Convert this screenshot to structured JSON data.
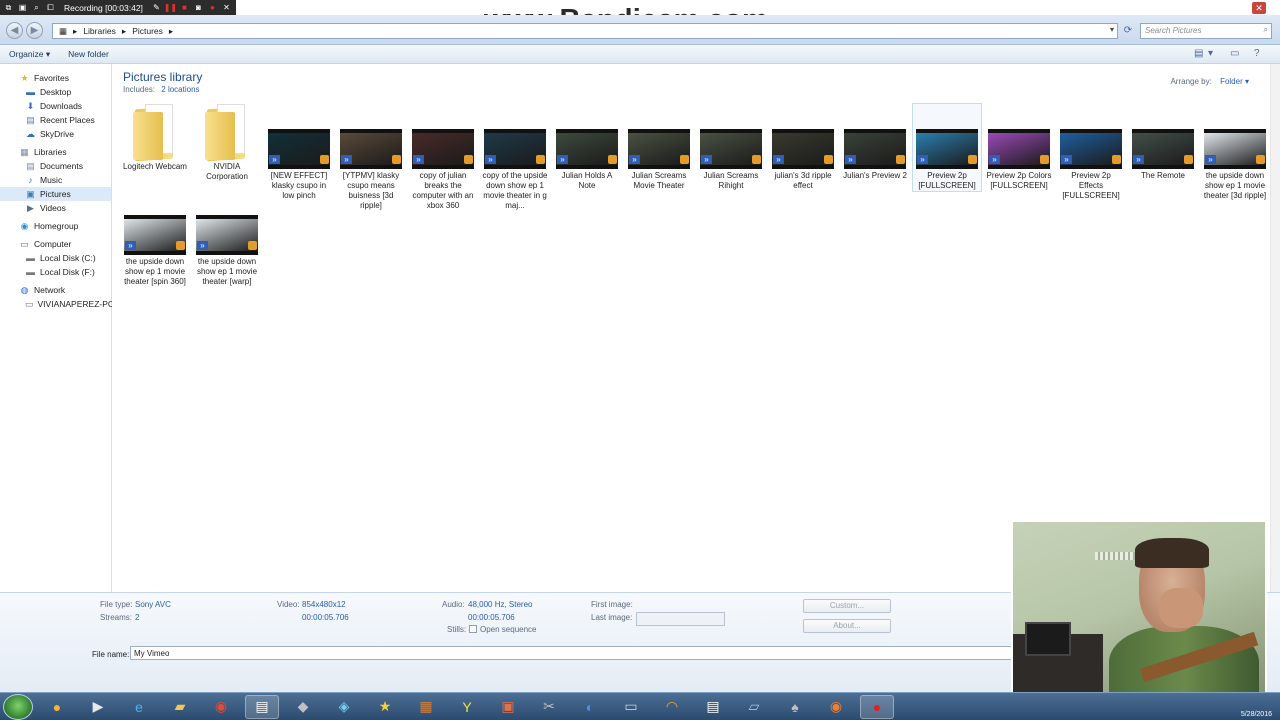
{
  "recorder": {
    "title": "Recording [00:03:42]",
    "watermark": "www.Bandicam.com"
  },
  "address_bar": {
    "segments": [
      "Libraries",
      "Pictures"
    ],
    "search_placeholder": "Search Pictures"
  },
  "command_bar": {
    "organize": "Organize",
    "new_folder": "New folder"
  },
  "nav_pane": {
    "favorites": "Favorites",
    "desktop": "Desktop",
    "downloads": "Downloads",
    "recent_places": "Recent Places",
    "skydrive": "SkyDrive",
    "libraries": "Libraries",
    "documents": "Documents",
    "music": "Music",
    "pictures": "Pictures",
    "videos": "Videos",
    "homegroup": "Homegroup",
    "computer": "Computer",
    "local_disk_c": "Local Disk (C:)",
    "local_disk_f": "Local Disk (F:)",
    "network": "Network",
    "network_pc": "VIVIANAPEREZ-PC"
  },
  "library": {
    "title": "Pictures library",
    "includes_label": "Includes:",
    "includes_link": "2 locations",
    "arrange_label": "Arrange by:",
    "arrange_value": "Folder"
  },
  "items": [
    {
      "label": "Logitech Webcam",
      "kind": "folder"
    },
    {
      "label": "NVIDIA Corporation",
      "kind": "folder"
    },
    {
      "label": "[NEW EFFECT] klasky csupo in low pinch",
      "kind": "video",
      "tint": "#12303a"
    },
    {
      "label": "[YTPMV] klasky csupo means buisness [3d ripple]",
      "kind": "video",
      "tint": "#5a4a3a"
    },
    {
      "label": "copy of julian breaks the computer with an xbox 360",
      "kind": "video",
      "tint": "#4a2a2a"
    },
    {
      "label": "copy of the upside down show ep 1 movie theater in g maj...",
      "kind": "video",
      "tint": "#1f3a4a"
    },
    {
      "label": "Julian Holds A Note",
      "kind": "video",
      "tint": "#3e4a3e"
    },
    {
      "label": "Julian Screams Movie Theater",
      "kind": "video",
      "tint": "#4a5242"
    },
    {
      "label": "Julian Screams Rihight",
      "kind": "video",
      "tint": "#4a5242"
    },
    {
      "label": "julian's 3d ripple effect",
      "kind": "video",
      "tint": "#3a3a30"
    },
    {
      "label": "Julian's Preview 2",
      "kind": "video",
      "tint": "#3a423a"
    },
    {
      "label": "Preview 2p [FULLSCREEN]",
      "kind": "video",
      "tint": "#2a7fb0"
    },
    {
      "label": "Preview 2p Colors [FULLSCREEN]",
      "kind": "video",
      "tint": "#9a4ab8"
    },
    {
      "label": "Preview 2p Effects [FULLSCREEN]",
      "kind": "video",
      "tint": "#1f5f9f"
    },
    {
      "label": "The Remote",
      "kind": "video",
      "tint": "#44504a"
    },
    {
      "label": "the upside down show ep 1 movie theater [3d ripple]",
      "kind": "video",
      "tint": "#dfe6ea"
    },
    {
      "label": "the upside down show ep 1 movie theater [spin 360]",
      "kind": "video",
      "tint": "#dfe6ea"
    },
    {
      "label": "the upside down show ep 1 movie theater [warp]",
      "kind": "video",
      "tint": "#dfe6ea"
    }
  ],
  "details": {
    "file_type_label": "File type:",
    "file_type": "Sony AVC",
    "streams_label": "Streams:",
    "streams": "2",
    "video_label": "Video:",
    "video": "854x480x12",
    "video_duration": "00:00:05.706",
    "audio_label": "Audio:",
    "audio": "48,000 Hz, Stereo",
    "audio_duration": "00:00:05.706",
    "stills_label": "Stills:",
    "stills_option": "Open sequence",
    "first_image_label": "First image:",
    "last_image_label": "Last image:",
    "custom_button": "Custom...",
    "about_button": "About...",
    "file_name_label": "File name:",
    "file_name": "My Vimeo"
  },
  "taskbar": {
    "tray_date": "5/28/2016"
  }
}
